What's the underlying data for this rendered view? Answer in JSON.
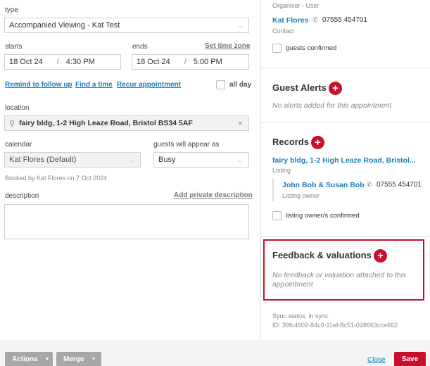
{
  "form": {
    "type_label": "type",
    "type_value": "Accompanied Viewing - Kat Test",
    "starts_label": "starts",
    "ends_label": "ends",
    "set_time_zone": "Set time zone",
    "start_date": "18 Oct 24",
    "start_time": "4:30 PM",
    "end_date": "18 Oct 24",
    "end_time": "5:00 PM",
    "sep": "/",
    "remind_link": "Remind to follow up",
    "find_time_link": "Find a time",
    "recur_link": "Recur appointment",
    "all_day_label": "all day",
    "location_label": "location",
    "location_value": "fairy bldg, 1-2 High Leaze Road, Bristol BS34 5AF",
    "calendar_label": "calendar",
    "calendar_value": "Kat Flores (Default)",
    "guests_appear_label": "guests will appear as",
    "guests_appear_value": "Busy",
    "booked_by": "Booked by Kat Flores on 7 Oct 2024",
    "description_label": "description",
    "add_private_description": "Add private description"
  },
  "organiser": {
    "role": "Organiser - User",
    "name": "Kat Flores",
    "phone": "07555 454701",
    "subrole": "Contact",
    "guests_confirmed_label": "guests confirmed"
  },
  "guest_alerts": {
    "title": "Guest Alerts",
    "empty": "No alerts added for this appointment"
  },
  "records": {
    "title": "Records",
    "listing_link": "fairy bldg, 1-2 High Leaze Road, Bristol...",
    "listing_label": "Listing",
    "owner_name": "John Bob & Susan Bob",
    "owner_phone": "07555 454701",
    "owner_label": "Listing owner",
    "owner_confirmed_label": "listing owner/s confirmed"
  },
  "feedback": {
    "title": "Feedback & valuations",
    "empty_line1": "No feedback or valuation attached to this",
    "empty_line2": "appointment"
  },
  "sync": {
    "status": "Sync status: in sync",
    "id": "ID: 39fc4602-84c0-11ef-8c51-028663cce662"
  },
  "footer": {
    "actions_label": "Actions",
    "merge_label": "Merge",
    "close_label": "Close",
    "save_label": "Save"
  },
  "colors": {
    "accent": "#c8102e",
    "link": "#1a7fb9",
    "highlight": "#c8102e"
  }
}
